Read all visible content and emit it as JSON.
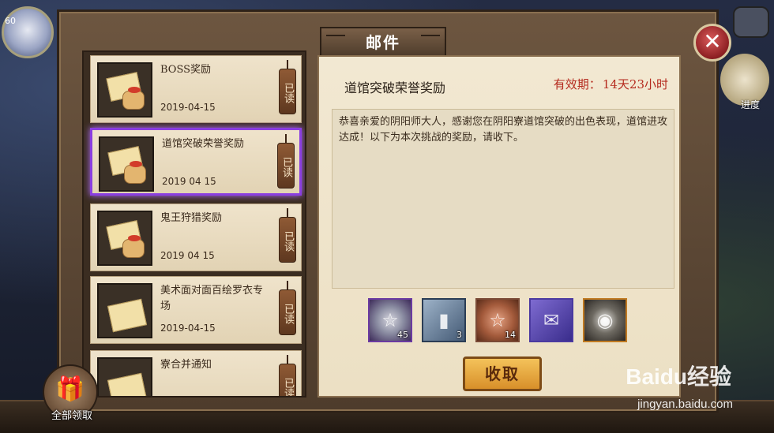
{
  "window": {
    "title": "邮件"
  },
  "top_left": {
    "level": "60"
  },
  "right_side": {
    "progress_label": "进度"
  },
  "mail_list": [
    {
      "title": "BOSS奖励",
      "date": "2019-04-15",
      "read": "已读"
    },
    {
      "title": "道馆突破荣誉奖励",
      "date": "2019 04 15",
      "read": "已读"
    },
    {
      "title": "鬼王狩猎奖励",
      "date": "2019 04 15",
      "read": "已读"
    },
    {
      "title": "美术面对面百绘罗衣专场",
      "date": "2019-04-15",
      "read": "已读"
    },
    {
      "title": "寮合并通知",
      "date": "",
      "read": "已读"
    }
  ],
  "detail": {
    "title": "道馆突破荣誉奖励",
    "expiry_label": "有效期：",
    "expiry_value": "14天23小时",
    "body": "恭喜亲爱的阴阳师大人，感谢您在阴阳寮道馆突破的出色表现，道馆进攻达成！以下为本次挑战的奖励，请收下。",
    "rewards": [
      {
        "icon": "silver-pentagram-coin-icon",
        "count": "45"
      },
      {
        "icon": "blank-scroll-card-icon",
        "count": "3"
      },
      {
        "icon": "bronze-pentagram-coin-icon",
        "count": "14"
      },
      {
        "icon": "blue-ticket-icon",
        "count": ""
      },
      {
        "icon": "daruma-icon",
        "count": ""
      }
    ],
    "collect_label": "收取"
  },
  "collect_all_label": "全部领取",
  "watermark": {
    "main": "Baidu经验",
    "sub": "jingyan.baidu.com"
  }
}
